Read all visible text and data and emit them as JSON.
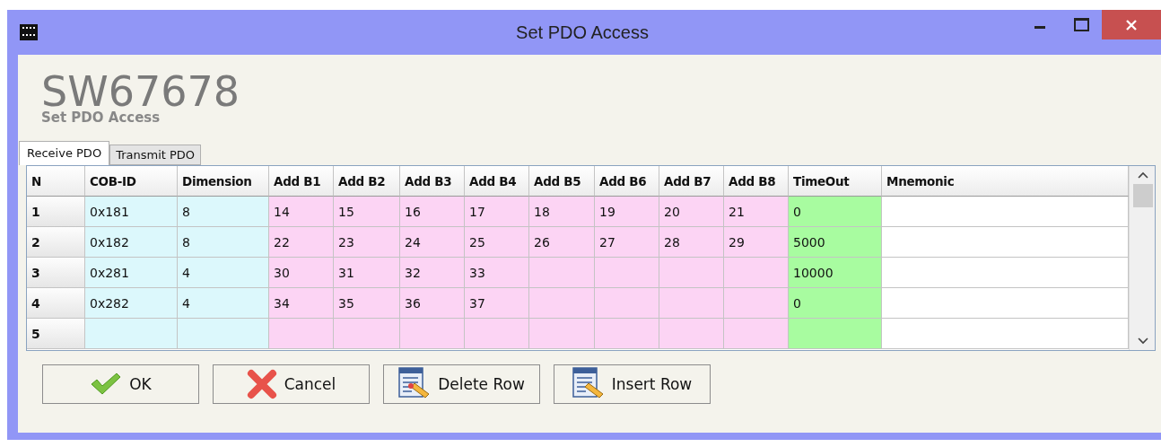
{
  "window": {
    "title": "Set PDO Access"
  },
  "header": {
    "product": "SW67678",
    "subtitle": "Set PDO Access"
  },
  "tabs": [
    {
      "label": "Receive PDO",
      "selected": true
    },
    {
      "label": "Transmit PDO",
      "selected": false
    }
  ],
  "table": {
    "columns": [
      {
        "label": "N",
        "kind": "index"
      },
      {
        "label": "COB-ID",
        "kind": "ident"
      },
      {
        "label": "Dimension",
        "kind": "ident"
      },
      {
        "label": "Add B1",
        "kind": "byte"
      },
      {
        "label": "Add B2",
        "kind": "byte"
      },
      {
        "label": "Add B3",
        "kind": "byte"
      },
      {
        "label": "Add B4",
        "kind": "byte"
      },
      {
        "label": "Add B5",
        "kind": "byte"
      },
      {
        "label": "Add B6",
        "kind": "byte"
      },
      {
        "label": "Add B7",
        "kind": "byte"
      },
      {
        "label": "Add B8",
        "kind": "byte"
      },
      {
        "label": "TimeOut",
        "kind": "timeout"
      },
      {
        "label": "Mnemonic",
        "kind": "text"
      }
    ],
    "rows": [
      [
        "1",
        "0x181",
        "8",
        "14",
        "15",
        "16",
        "17",
        "18",
        "19",
        "20",
        "21",
        "0",
        null
      ],
      [
        "2",
        "0x182",
        "8",
        "22",
        "23",
        "24",
        "25",
        "26",
        "27",
        "28",
        "29",
        "5000",
        null
      ],
      [
        "3",
        "0x281",
        "4",
        "30",
        "31",
        "32",
        "33",
        null,
        null,
        null,
        null,
        "10000",
        null
      ],
      [
        "4",
        "0x282",
        "4",
        "34",
        "35",
        "36",
        "37",
        null,
        null,
        null,
        null,
        "0",
        null
      ],
      [
        "5",
        null,
        null,
        null,
        null,
        null,
        null,
        null,
        null,
        null,
        null,
        null,
        null
      ]
    ]
  },
  "buttons": [
    {
      "label": "OK",
      "kind": "ok"
    },
    {
      "label": "Cancel",
      "kind": "cancel"
    },
    {
      "label": "Delete Row",
      "kind": "delete"
    },
    {
      "label": "Insert Row",
      "kind": "insert"
    }
  ]
}
